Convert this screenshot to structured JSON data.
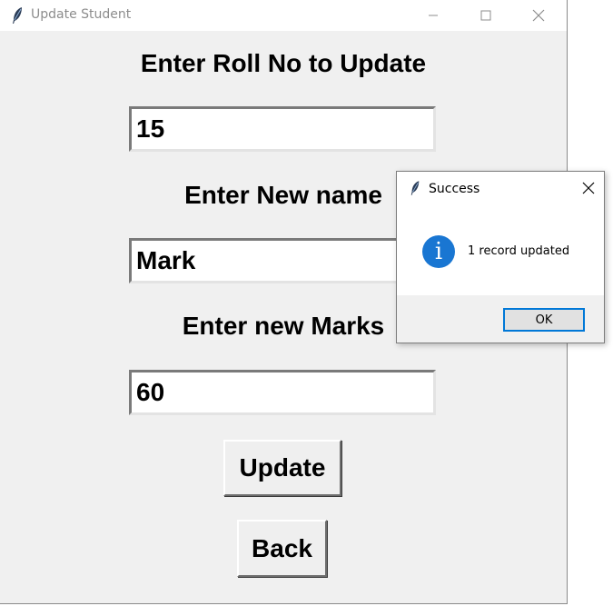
{
  "window": {
    "title": "Update Student",
    "minimize_icon": "minimize-icon",
    "maximize_icon": "maximize-icon",
    "close_icon": "close-icon",
    "app_icon": "feather-icon"
  },
  "form": {
    "roll_label": "Enter Roll No to Update",
    "roll_value": "15",
    "name_label": "Enter New name",
    "name_value": "Mark",
    "marks_label": "Enter new Marks",
    "marks_value": "60",
    "update_button": "Update",
    "back_button": "Back"
  },
  "dialog": {
    "title": "Success",
    "message": "1 record updated",
    "ok_button": "OK",
    "icon": "info-icon",
    "icon_color": "#1976d2"
  }
}
